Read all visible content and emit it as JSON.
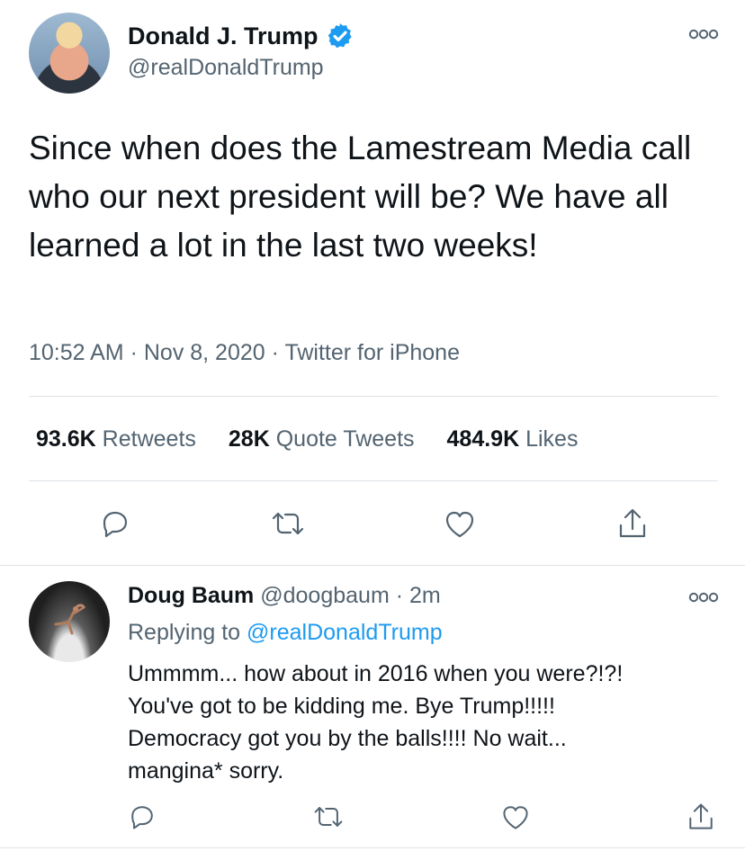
{
  "tweet": {
    "author_name": "Donald J. Trump",
    "author_handle": "@realDonaldTrump",
    "text": "Since when does the Lamestream Media call who our next president will be? We have all learned a lot in the last two weeks!",
    "time": "10:52 AM",
    "date": "Nov 8, 2020",
    "source": "Twitter for iPhone",
    "meta_separator": " · ",
    "stats": {
      "retweets_count": "93.6K",
      "retweets_label": "Retweets",
      "quotes_count": "28K",
      "quotes_label": "Quote Tweets",
      "likes_count": "484.9K",
      "likes_label": "Likes"
    }
  },
  "reply": {
    "author_name": "Doug Baum",
    "author_handle": "@doogbaum",
    "time_ago": "2m",
    "separator": " · ",
    "replying_to_label": "Replying to",
    "replying_to_handle": "@realDonaldTrump",
    "text_lines": [
      "Ummmm... how about in 2016 when you were?!?!",
      "You've got to be kidding me. Bye Trump!!!!!",
      "Democracy got you by the balls!!!!  No wait...",
      "mangina* sorry."
    ]
  },
  "icons": {
    "verified": "verified-badge-icon",
    "more": "more-options-icon",
    "reply": "reply-icon",
    "retweet": "retweet-icon",
    "like": "heart-icon",
    "share": "share-icon"
  },
  "colors": {
    "accent": "#1d9bf0",
    "secondary_text": "#536471",
    "primary_text": "#0f1419",
    "divider": "#dfe3e6"
  }
}
